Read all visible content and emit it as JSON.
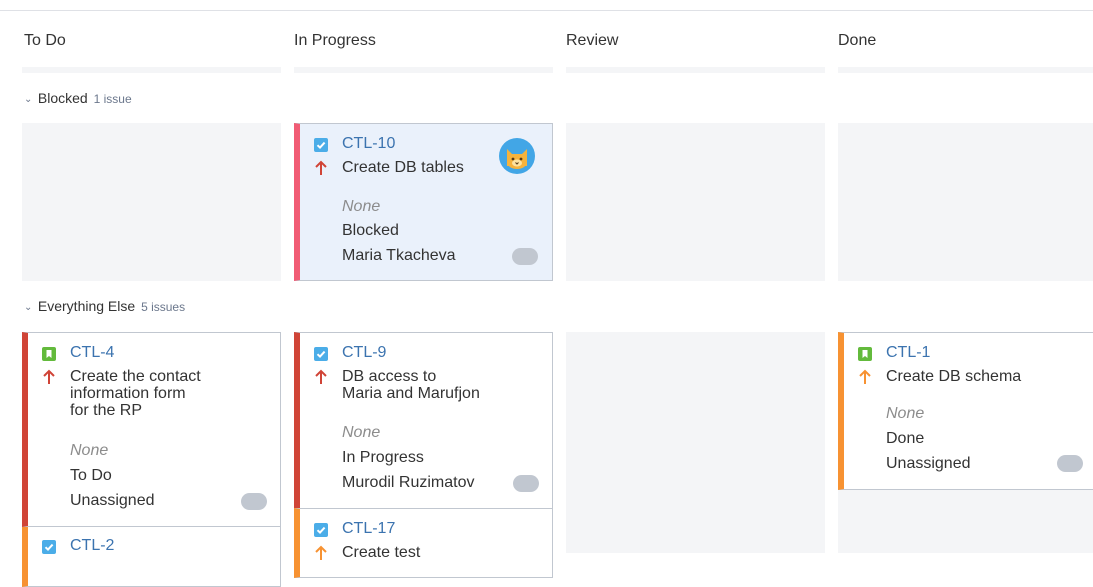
{
  "columns": [
    "To Do",
    "In Progress",
    "Review",
    "Done"
  ],
  "swimlanes": [
    {
      "label": "Blocked",
      "count": "1 issue"
    },
    {
      "label": "Everything Else",
      "count": "5 issues"
    }
  ],
  "cards": {
    "ctl10": {
      "key": "CTL-10",
      "summary": "Create DB tables",
      "field1": "None",
      "status": "Blocked",
      "assignee": "Maria Tkacheva"
    },
    "ctl4": {
      "key": "CTL-4",
      "summary_lines": [
        "Create the contact",
        "information form",
        "for the RP"
      ],
      "field1": "None",
      "status": "To Do",
      "assignee": "Unassigned"
    },
    "ctl9": {
      "key": "CTL-9",
      "summary_lines": [
        "DB access to",
        "Maria and Marufjon"
      ],
      "field1": "None",
      "status": "In Progress",
      "assignee": "Murodil Ruzimatov"
    },
    "ctl17": {
      "key": "CTL-17",
      "summary": "Create test"
    },
    "ctl1": {
      "key": "CTL-1",
      "summary": "Create DB schema",
      "field1": "None",
      "status": "Done",
      "assignee": "Unassigned"
    },
    "ctl2": {
      "key": "CTL-2"
    }
  },
  "colors": {
    "link": "#3b73af",
    "high_priority": "#d04437",
    "medium_priority": "#f79232",
    "flagged": "#f15c75",
    "task_icon": "#4bade8",
    "story_icon": "#63ba3c"
  },
  "icons": {
    "task": "checkbox-icon",
    "story": "bookmark-icon",
    "priority_high": "arrow-up-icon",
    "priority_medium": "arrow-up-icon",
    "avatar": "cat-avatar-icon"
  }
}
